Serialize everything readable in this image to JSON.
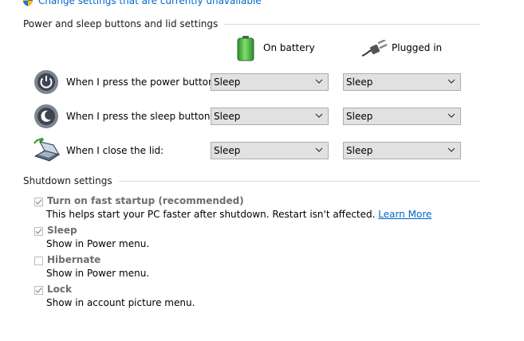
{
  "top_link": {
    "label": "Change settings that are currently unavailable",
    "icon": "shield-icon"
  },
  "section_power": {
    "title": "Power and sleep buttons and lid settings"
  },
  "columns": {
    "battery": {
      "label": "On battery",
      "icon": "battery-icon"
    },
    "plugged": {
      "label": "Plugged in",
      "icon": "plug-icon"
    }
  },
  "rows": [
    {
      "label": "When I press the power button:",
      "icon": "power-button-icon",
      "battery": "Sleep",
      "plugged": "Sleep"
    },
    {
      "label": "When I press the sleep button:",
      "icon": "sleep-button-icon",
      "battery": "Sleep",
      "plugged": "Sleep"
    },
    {
      "label": "When I close the lid:",
      "icon": "laptop-lid-icon",
      "battery": "Sleep",
      "plugged": "Sleep"
    }
  ],
  "section_shutdown": {
    "title": "Shutdown settings"
  },
  "shutdown_options": [
    {
      "label": "Turn on fast startup (recommended)",
      "checked": true,
      "desc": "This helps start your PC faster after shutdown. Restart isn't affected.",
      "link": "Learn More"
    },
    {
      "label": "Sleep",
      "checked": true,
      "desc": "Show in Power menu."
    },
    {
      "label": "Hibernate",
      "checked": false,
      "desc": "Show in Power menu."
    },
    {
      "label": "Lock",
      "checked": true,
      "desc": "Show in account picture menu."
    }
  ],
  "colors": {
    "link": "#0066cc",
    "disabled_text": "#6d6d6d",
    "dropdown_bg": "#e1e1e1",
    "battery_green": "#3cb043"
  }
}
